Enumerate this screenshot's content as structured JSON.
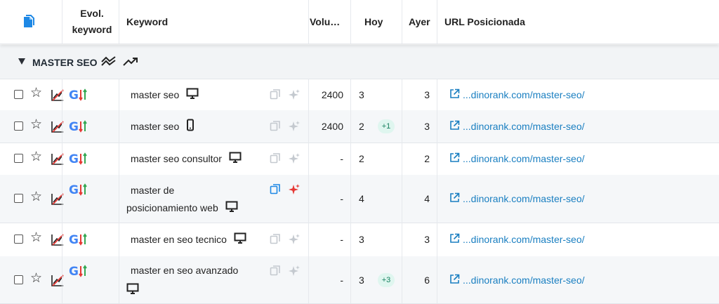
{
  "header": {
    "evol_keyword": "Evol.\nkeyword",
    "evol_line1": "Evol.",
    "evol_line2": "keyword",
    "keyword": "Keyword",
    "volume": "Volu…",
    "hoy": "Hoy",
    "ayer": "Ayer",
    "url": "URL Posicionada"
  },
  "group": {
    "title": "MASTER SEO"
  },
  "rows": [
    {
      "keyword_line1": "master seo",
      "keyword_line2": "",
      "device": "desktop-icon",
      "volume": "2400",
      "hoy": "3",
      "badge": "",
      "ayer": "3",
      "url": "...dinorank.com/master-seo/"
    },
    {
      "keyword_line1": "master seo",
      "keyword_line2": "",
      "device": "mobile-icon",
      "volume": "2400",
      "hoy": "2",
      "badge": "+1",
      "ayer": "3",
      "url": "...dinorank.com/master-seo/"
    },
    {
      "keyword_line1": "master seo consultor",
      "keyword_line2": "",
      "device": "desktop-icon",
      "volume": "-",
      "hoy": "2",
      "badge": "",
      "ayer": "2",
      "url": "...dinorank.com/master-seo/"
    },
    {
      "keyword_line1": "master de",
      "keyword_line2": "posicionamiento web",
      "device": "desktop-icon",
      "volume": "-",
      "hoy": "4",
      "badge": "",
      "ayer": "4",
      "url": "...dinorank.com/master-seo/"
    },
    {
      "keyword_line1": "master en seo tecnico",
      "keyword_line2": "",
      "device": "desktop-icon",
      "volume": "-",
      "hoy": "3",
      "badge": "",
      "ayer": "3",
      "url": "...dinorank.com/master-seo/"
    },
    {
      "keyword_line1": "master en seo avanzado",
      "keyword_line2": "",
      "device": "desktop-icon",
      "volume": "-",
      "hoy": "3",
      "badge": "+3",
      "ayer": "6",
      "url": "...dinorank.com/master-seo/"
    }
  ],
  "colors": {
    "link": "#1a7fc1",
    "accent_red": "#e53935",
    "badge_bg": "#dff6ef",
    "badge_text": "#17805f",
    "row_alt": "#f5f7f9"
  }
}
